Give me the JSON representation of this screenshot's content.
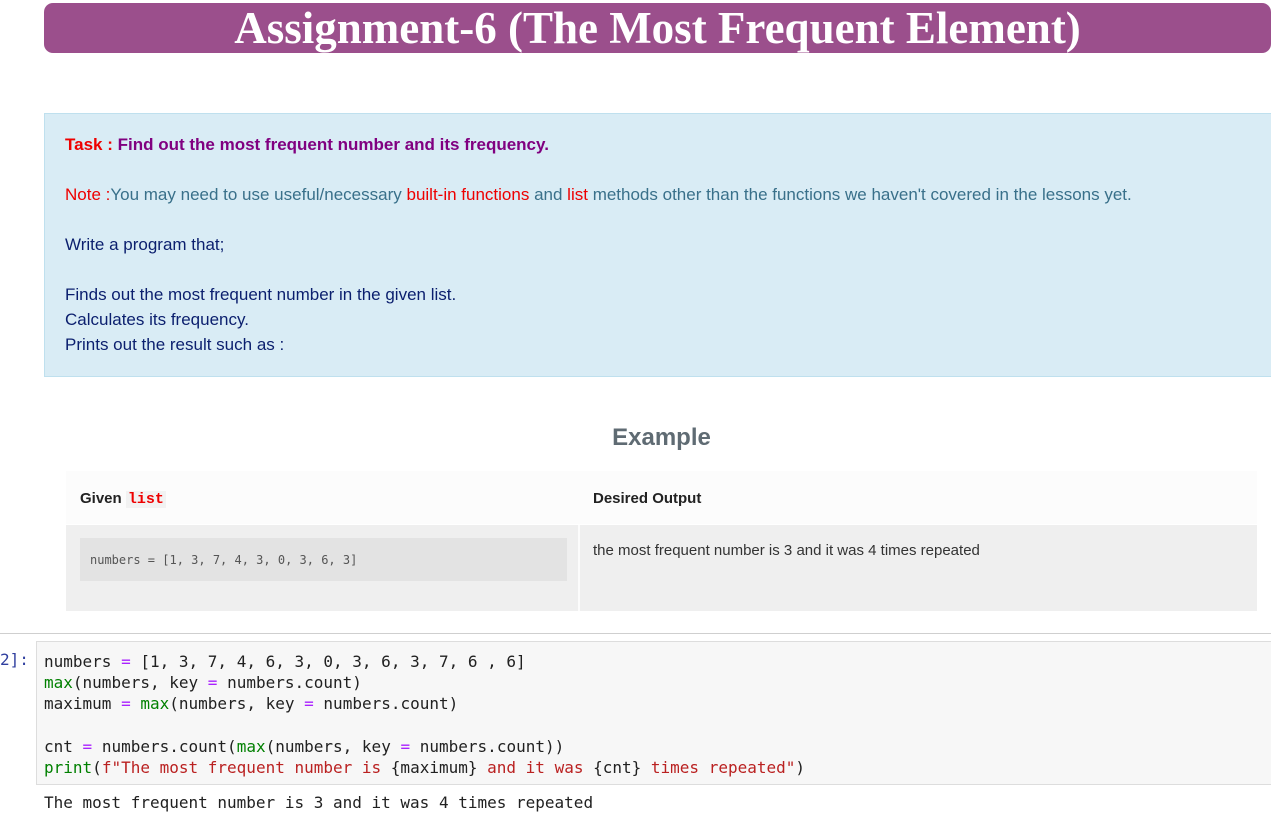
{
  "header": {
    "title": "Assignment-6 (The Most Frequent Element)"
  },
  "task_box": {
    "task_label": "Task :",
    "task_text": "Find out the most frequent number and its frequency.",
    "note_label": "Note :",
    "note_part1": "You may need to use useful/necessary",
    "note_highlight1": "built-in functions",
    "note_part2": "and",
    "note_highlight2": "list",
    "note_part3": "methods other than the functions we haven't covered in the lessons yet.",
    "write_line": "Write a program that;",
    "steps": [
      "Finds out the most frequent number in the given list.",
      "Calculates its frequency.",
      "Prints out the result such as :"
    ]
  },
  "example": {
    "heading": "Example",
    "col_given_label": "Given",
    "col_given_code": "list",
    "col_output_label": "Desired Output",
    "given_code": "numbers = [1, 3, 7, 4, 3, 0, 3, 6, 3]",
    "desired_output": "the most frequent number is 3 and it was 4 times repeated"
  },
  "code_cell": {
    "prompt": "2]:",
    "lines": [
      {
        "t1": "numbers",
        "op1": "=",
        "t2": "[1, 3, 7, 4, 6, 3, 0, 3, 6, 3, 7, 6 , 6]"
      },
      {
        "fn": "max",
        "t1": "(numbers, key",
        "op1": "=",
        "t2": "numbers.count)"
      },
      {
        "t0": "maximum",
        "op0": "=",
        "fn": "max",
        "t1": "(numbers, key",
        "op1": "=",
        "t2": "numbers.count)"
      },
      {},
      {
        "t0": "cnt",
        "op0": "=",
        "t1": "numbers.count(",
        "fn": "max",
        "t2": "(numbers, key",
        "op1": "=",
        "t3": "numbers.count))"
      },
      {
        "fn": "print",
        "t1": "(",
        "s1": "f\"The most frequent number is ",
        "v1": "{maximum}",
        "s2": " and it was ",
        "v2": "{cnt}",
        "s3": " times repeated\"",
        "t2": ")"
      }
    ]
  },
  "output": {
    "text": "The most frequent number is 3 and it was 4 times repeated"
  }
}
